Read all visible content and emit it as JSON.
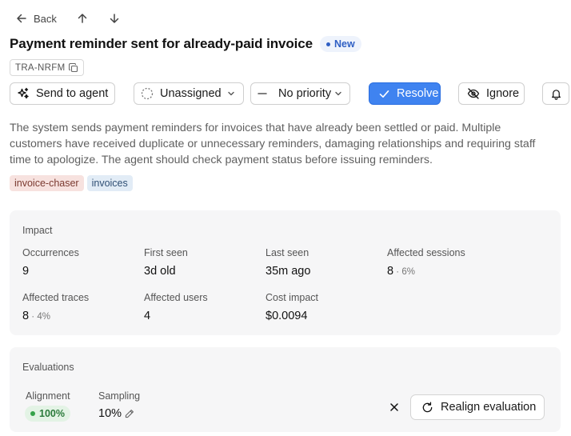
{
  "nav": {
    "back_label": "Back"
  },
  "issue": {
    "title": "Payment reminder sent for already-paid invoice",
    "status_badge": "New",
    "id": "TRA-NRFM",
    "description": "The system sends payment reminders for invoices that have already been settled or paid. Multiple customers have received duplicate or unnecessary reminders, damaging relationships and requiring staff time to apologize. The agent should check payment status before issuing reminders.",
    "tags": [
      "invoice-chaser",
      "invoices"
    ]
  },
  "toolbar": {
    "send_to_agent": "Send to agent",
    "assignee": "Unassigned",
    "priority": "No priority",
    "resolve": "Resolve",
    "ignore": "Ignore"
  },
  "impact": {
    "title": "Impact",
    "occurrences_label": "Occurrences",
    "occurrences": "9",
    "first_seen_label": "First seen",
    "first_seen": "3d old",
    "last_seen_label": "Last seen",
    "last_seen": "35m ago",
    "affected_sessions_label": "Affected sessions",
    "affected_sessions": "8",
    "affected_sessions_pct": "6%",
    "affected_traces_label": "Affected traces",
    "affected_traces": "8",
    "affected_traces_pct": "4%",
    "affected_users_label": "Affected users",
    "affected_users": "4",
    "cost_impact_label": "Cost impact",
    "cost_impact": "$0.0094"
  },
  "evaluations": {
    "title": "Evaluations",
    "alignment_label": "Alignment",
    "alignment": "100%",
    "sampling_label": "Sampling",
    "sampling": "10%",
    "realign_label": "Realign evaluation"
  },
  "colors": {
    "primary": "#3f83f0",
    "badge_blue": "#2f5fc4",
    "success": "#35a24a"
  }
}
